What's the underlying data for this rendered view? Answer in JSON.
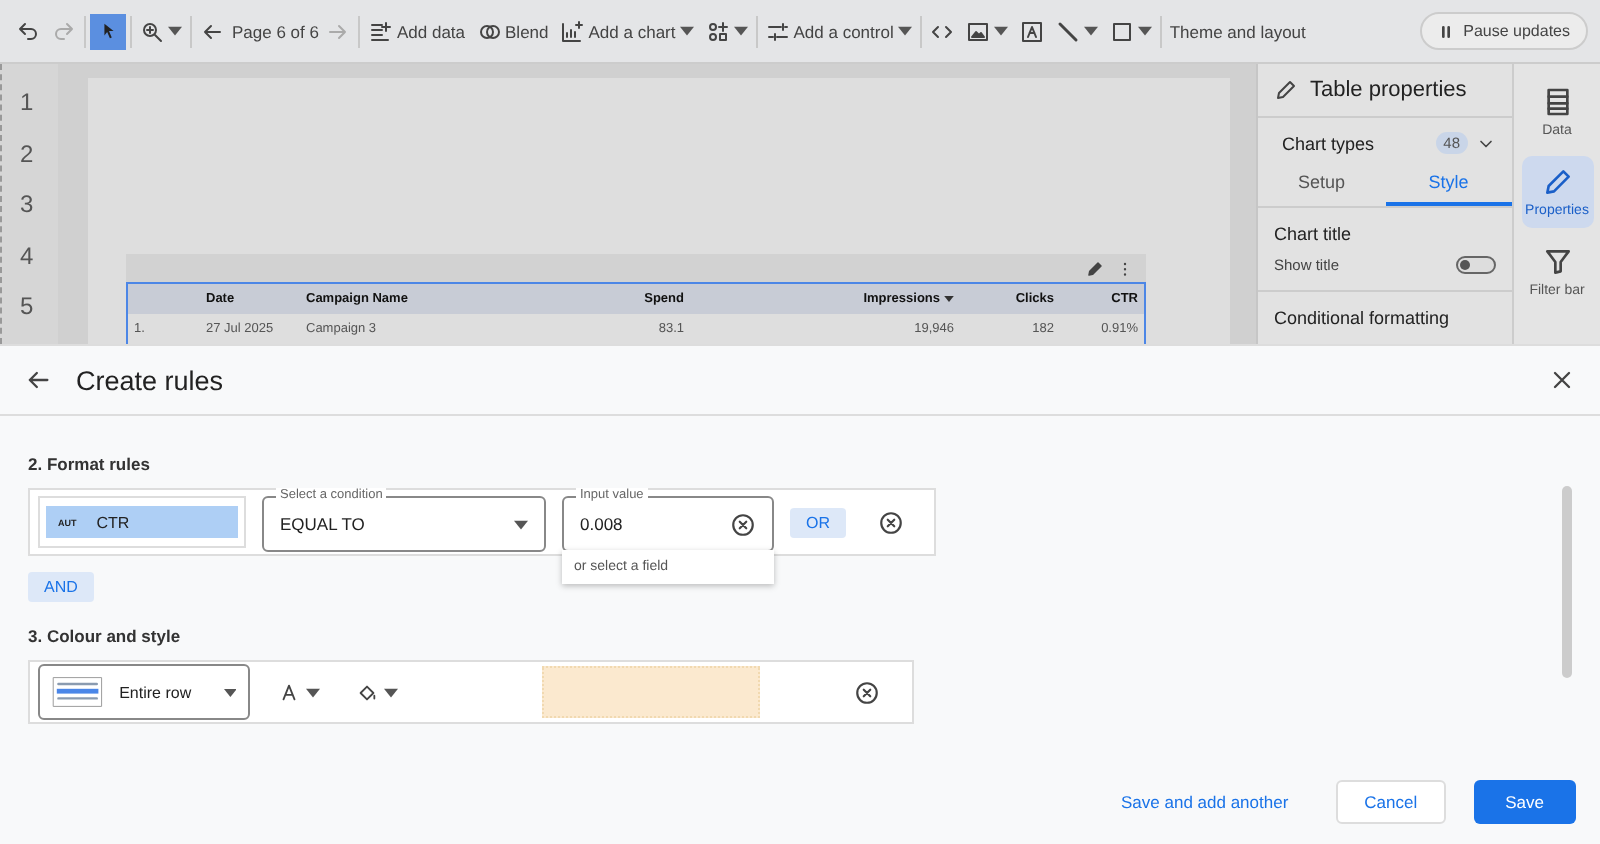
{
  "toolbar": {
    "select_tool": {
      "selected": true
    },
    "page_label": "Page 6 of 6",
    "buttons": [
      {
        "label": "Add data",
        "kind": "data"
      },
      {
        "label": "Blend",
        "kind": "blend"
      },
      {
        "label": "Add a chart",
        "kind": "chart"
      }
    ],
    "control_button": "Add a control",
    "theme_button": "Theme and layout",
    "pause_button": "Pause updates"
  },
  "ruler": [
    "1",
    "2",
    "3",
    "4",
    "5"
  ],
  "table": {
    "columns": [
      {
        "sorted": false
      },
      {
        "label": "Date",
        "sorted": false
      },
      {
        "label": "Campaign Name",
        "sorted": false
      },
      {
        "label": "Spend",
        "sorted": false
      },
      {
        "label": "Impressions",
        "sorted": true
      },
      {
        "label": "Clicks",
        "sorted": false
      },
      {
        "label": "CTR",
        "sorted": false
      }
    ],
    "rows": [
      [
        "1.",
        "27 Jul 2025",
        "Campaign 3",
        "83.1",
        "19,946",
        "182",
        "0.91%"
      ]
    ]
  },
  "properties": {
    "title": "Table properties",
    "chart_types": "Chart types",
    "chart_types_count": "48",
    "tabs": [
      {
        "label": "Setup",
        "selected": false
      },
      {
        "label": "Style",
        "selected": true
      }
    ],
    "chart_title": "Chart title",
    "show_title": {
      "label": "Show title",
      "on": false
    },
    "conditional_formatting": "Conditional formatting"
  },
  "rail": [
    {
      "label": "Data",
      "kind": "data",
      "selected": false
    },
    {
      "label": "Properties",
      "kind": "properties",
      "selected": true
    },
    {
      "label": "Filter bar",
      "kind": "filter",
      "selected": false
    }
  ],
  "dialog": {
    "title": "Create rules",
    "format_section": "2. Format rules",
    "field": {
      "type_tag": "AUT",
      "name": "CTR"
    },
    "condition": {
      "label": "Select a condition",
      "value": "EQUAL TO"
    },
    "input": {
      "label": "Input value",
      "value": "0.008",
      "hint": "or select a field"
    },
    "or_button": "OR",
    "and_button": "AND",
    "style_section": "3. Colour and style",
    "style": {
      "apply_to": "Entire row",
      "color": "#fbe9cf"
    },
    "footer": [
      "Save and add another",
      "Cancel",
      "Save"
    ]
  }
}
